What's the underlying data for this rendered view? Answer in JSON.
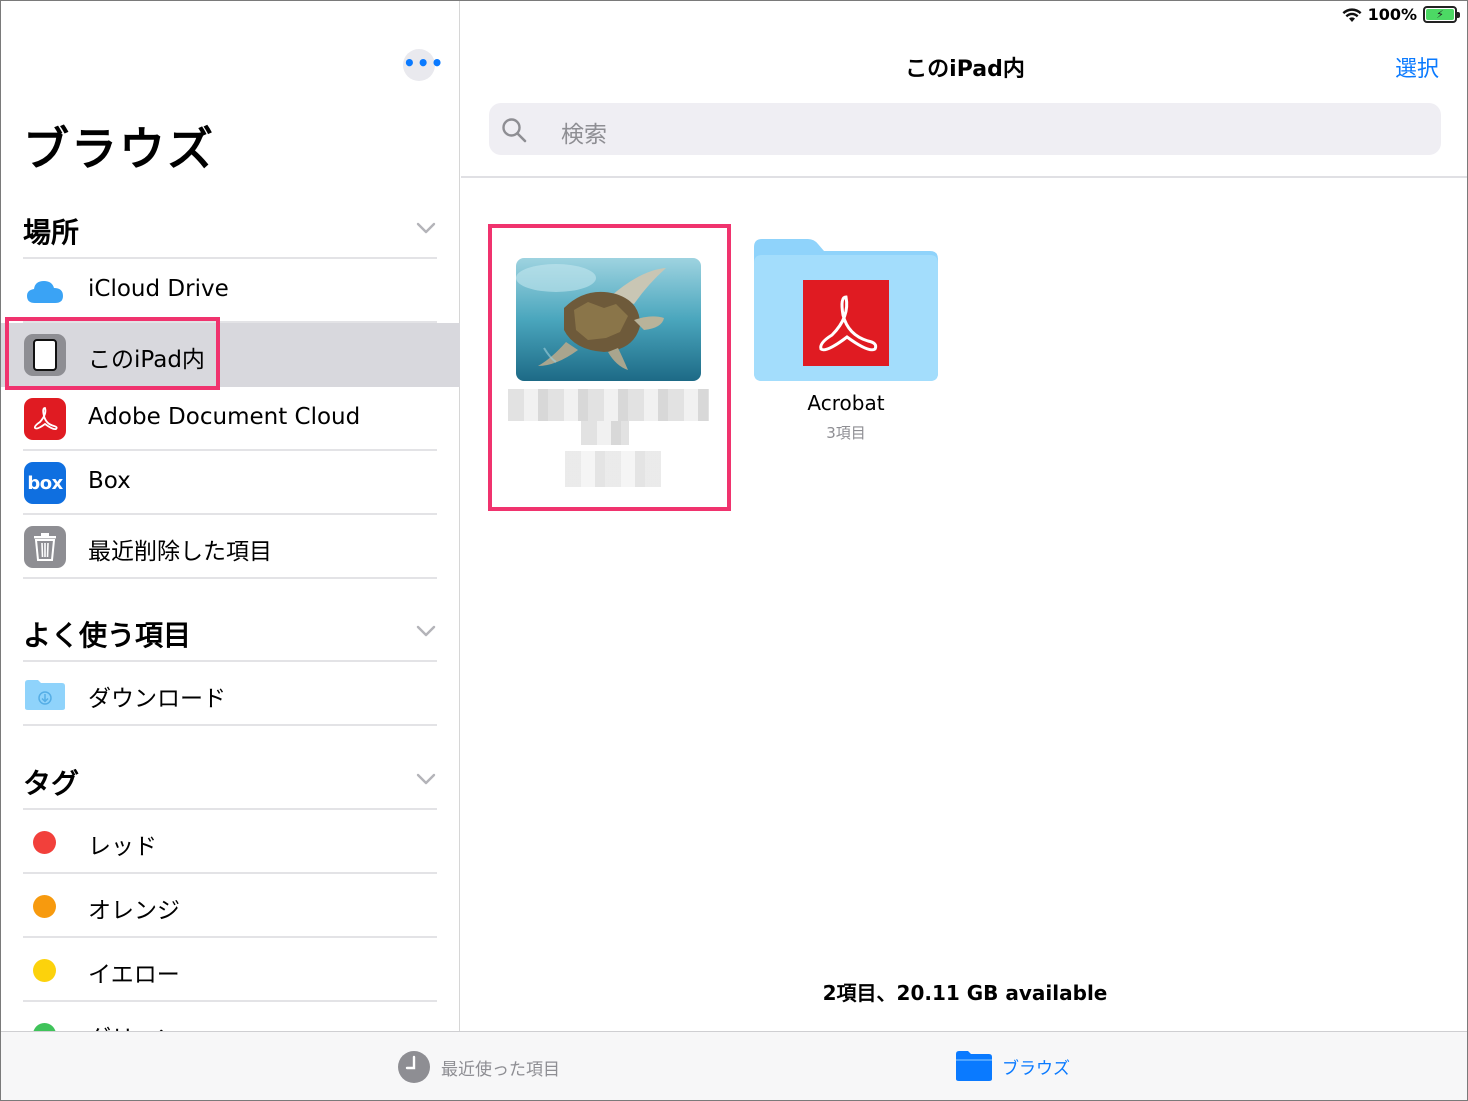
{
  "status_bar": {
    "battery_percent": "100%"
  },
  "sidebar": {
    "more_label": "•••",
    "title": "ブラウズ",
    "locations": {
      "header": "場所",
      "items": [
        {
          "label": "iCloud Drive",
          "icon": "icloud-icon"
        },
        {
          "label": "このiPad内",
          "icon": "ipad-icon",
          "selected": true
        },
        {
          "label": "Adobe Document Cloud",
          "icon": "adobe-icon"
        },
        {
          "label": "Box",
          "icon": "box-icon",
          "icon_text": "box"
        },
        {
          "label": "最近削除した項目",
          "icon": "trash-icon"
        }
      ]
    },
    "favorites": {
      "header": "よく使う項目",
      "items": [
        {
          "label": "ダウンロード",
          "icon": "downloads-folder-icon"
        }
      ]
    },
    "tags": {
      "header": "タグ",
      "items": [
        {
          "label": "レッド",
          "color": "#f2403b"
        },
        {
          "label": "オレンジ",
          "color": "#f79a0e"
        },
        {
          "label": "イエロー",
          "color": "#fcd20c"
        },
        {
          "label": "グリーン",
          "color": "#3fc35a"
        }
      ]
    }
  },
  "main": {
    "title": "このiPad内",
    "select_label": "選択",
    "search_placeholder": "検索",
    "files": [
      {
        "type": "image",
        "icon": "turtle-photo-thumbnail"
      },
      {
        "type": "folder",
        "name": "Acrobat",
        "count": "3項目",
        "icon": "acrobat-folder-icon"
      }
    ],
    "footer_status": "2項目、20.11 GB available"
  },
  "tabbar": {
    "recent_label": "最近使った項目",
    "browse_label": "ブラウズ"
  },
  "colors": {
    "accent": "#0a7aff",
    "highlight": "#f0336e",
    "selected_row": "#d8d8dd"
  }
}
